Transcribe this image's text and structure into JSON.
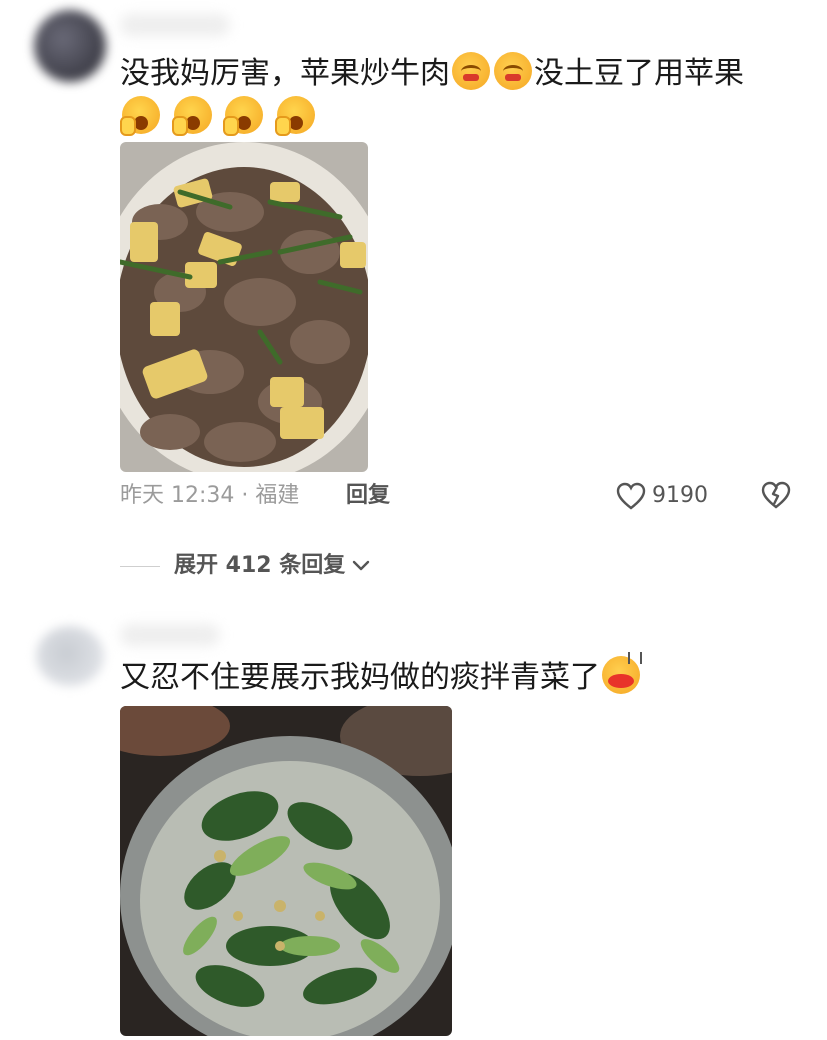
{
  "comments": [
    {
      "text": "没我妈厉害，苹果炒牛肉",
      "text_after_emoji": "没土豆了用苹果",
      "photo_alt": "beef-stir-fry-photo",
      "time_location": "昨天 12:34 · 福建",
      "reply_label": "回复",
      "like_count": "9190",
      "expand_label": "展开 412 条回复"
    },
    {
      "text": "又忍不住要展示我妈做的痰拌青菜了",
      "photo_alt": "greens-soup-photo"
    }
  ],
  "icons": {
    "like": "heart-outline-icon",
    "dislike": "broken-heart-icon",
    "expand": "chevron-down-icon"
  },
  "colors": {
    "primary_text": "#1a1a1a",
    "secondary_text": "#9b9b9b",
    "action_text": "#555555"
  }
}
